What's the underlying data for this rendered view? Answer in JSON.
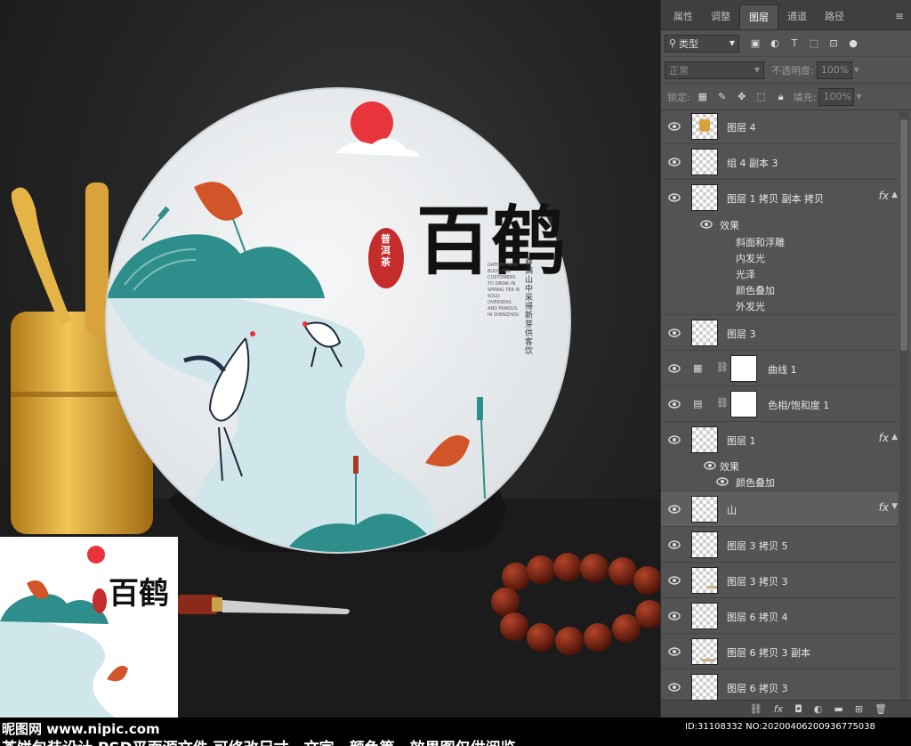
{
  "artwork": {
    "title_text": "百鹤",
    "seal_text": "普洱茶",
    "tagline_cn": "春满山中采得新芽供客饮",
    "tagline_en": [
      "GATHER NEW BUDS FOR CUSTOMERS",
      "TO DRINK IN SPRING TEA IS SOLD OVERSEAS",
      "AND FAMOUS IN SHENZHOU"
    ],
    "colors": {
      "teal": "#2e8e8c",
      "leaf": "#d2552a",
      "sun": "#e8343b",
      "river": "#cfe6ea",
      "disc": "#eef1f3"
    }
  },
  "panel": {
    "tabs": [
      {
        "label": "属性",
        "active": false
      },
      {
        "label": "调整",
        "active": false
      },
      {
        "label": "图层",
        "active": true
      },
      {
        "label": "通道",
        "active": false
      },
      {
        "label": "路径",
        "active": false
      }
    ],
    "filter": {
      "label": "类型"
    },
    "blend_mode": "正常",
    "opacity_label": "不透明度:",
    "opacity_value": "100%",
    "lock_label": "锁定:",
    "fill_label": "填充:",
    "fill_value": "100%",
    "layers_top": [
      {
        "name": "图层 4",
        "fx": false
      },
      {
        "name": "组 4 副本 3",
        "fx": false
      }
    ],
    "layer_fx1": {
      "name": "图层 1 拷贝 副本 拷贝",
      "effects_label": "效果",
      "effects": [
        "斜面和浮雕",
        "内发光",
        "光泽",
        "颜色叠加",
        "外发光"
      ]
    },
    "layer_3": {
      "name": "图层 3"
    },
    "adj_curves": {
      "name": "曲线 1",
      "icon": "curves-icon"
    },
    "adj_huesat": {
      "name": "色相/饱和度 1",
      "icon": "hue-saturation-icon"
    },
    "layer_1": {
      "name": "图层 1",
      "effects_label": "效果",
      "effect": "颜色叠加"
    },
    "layers_bottom": [
      {
        "name": "山"
      },
      {
        "name": "图层 3 拷贝 5"
      },
      {
        "name": "图层 3 拷贝 3"
      },
      {
        "name": "图层 6 拷贝 4"
      },
      {
        "name": "图层 6 拷贝 3 副本"
      },
      {
        "name": "图层 6 拷贝 3"
      }
    ]
  },
  "footer": {
    "watermark": "昵图网 www.nipic.com",
    "id_text": "ID:31108332 NO:20200406200936775038",
    "description": "茶饼包装设计 PSD平面源文件 可修改尺寸、文字、颜色等，效果图仅供阅览"
  }
}
